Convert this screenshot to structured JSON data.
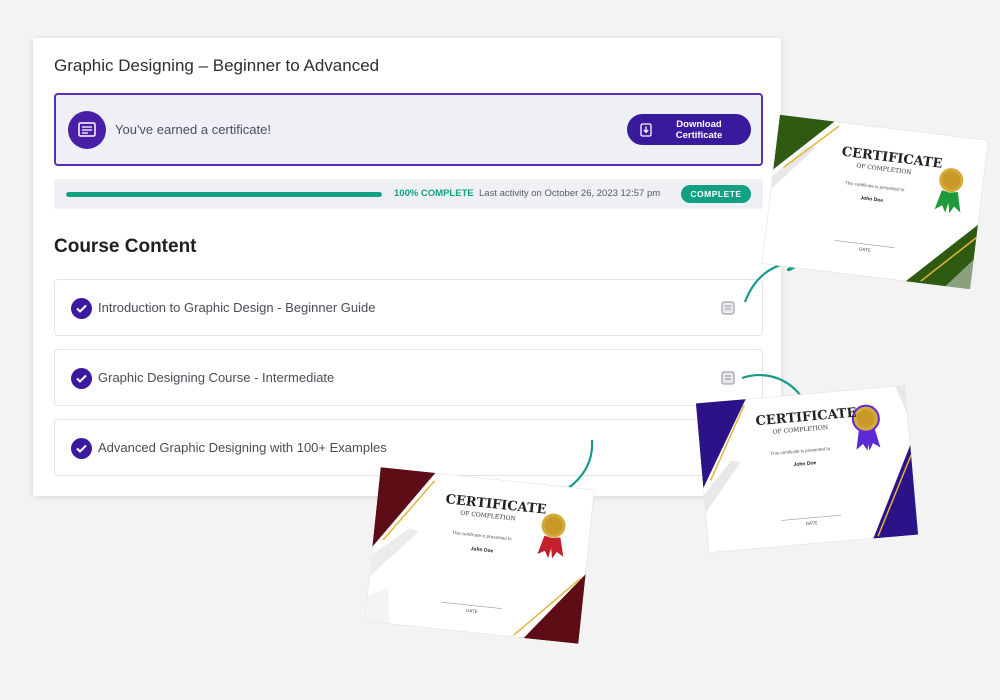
{
  "course": {
    "title": "Graphic Designing – Beginner to Advanced"
  },
  "certificate_banner": {
    "text": "You've earned a certificate!",
    "download_label_line1": "Download",
    "download_label_line2": "Certificate"
  },
  "progress": {
    "fraction": 1.0,
    "percent_text": "100% COMPLETE",
    "activity_text": "Last activity on October 26, 2023 12:57 pm",
    "status": "COMPLETE"
  },
  "content": {
    "heading": "Course Content",
    "lessons": [
      {
        "label": "Introduction to Graphic Design - Beginner Guide"
      },
      {
        "label": "Graphic Designing Course - Intermediate"
      },
      {
        "label": "Advanced Graphic Designing with 100+ Examples"
      }
    ]
  },
  "certificates": [
    {
      "title": "CERTIFICATE",
      "subtitle": "OF COMPLETION",
      "presented": "This certificate is presented to",
      "name": "John Doe",
      "date_label": "DATE",
      "theme_color": "#2e5a12",
      "seal_ribbon": "#1f9a3a"
    },
    {
      "title": "CERTIFICATE",
      "subtitle": "OF COMPLETION",
      "presented": "This certificate is presented to",
      "name": "John Doe",
      "date_label": "DATE",
      "theme_color": "#2b1387",
      "seal_ribbon": "#5b2ad6"
    },
    {
      "title": "CERTIFICATE",
      "subtitle": "OF COMPLETION",
      "presented": "This certificate is presented to",
      "name": "John Doe",
      "date_label": "DATE",
      "theme_color": "#5c0d16",
      "seal_ribbon": "#c0212c"
    }
  ],
  "colors": {
    "accent": "#3c1a9e",
    "success": "#12a085",
    "arrow": "#159a8c",
    "gold": "#e3b53a"
  },
  "icons": {
    "banner": "certificate-icon",
    "download": "download-icon",
    "check": "check-circle-icon",
    "lesson": "lesson-doc-icon"
  }
}
